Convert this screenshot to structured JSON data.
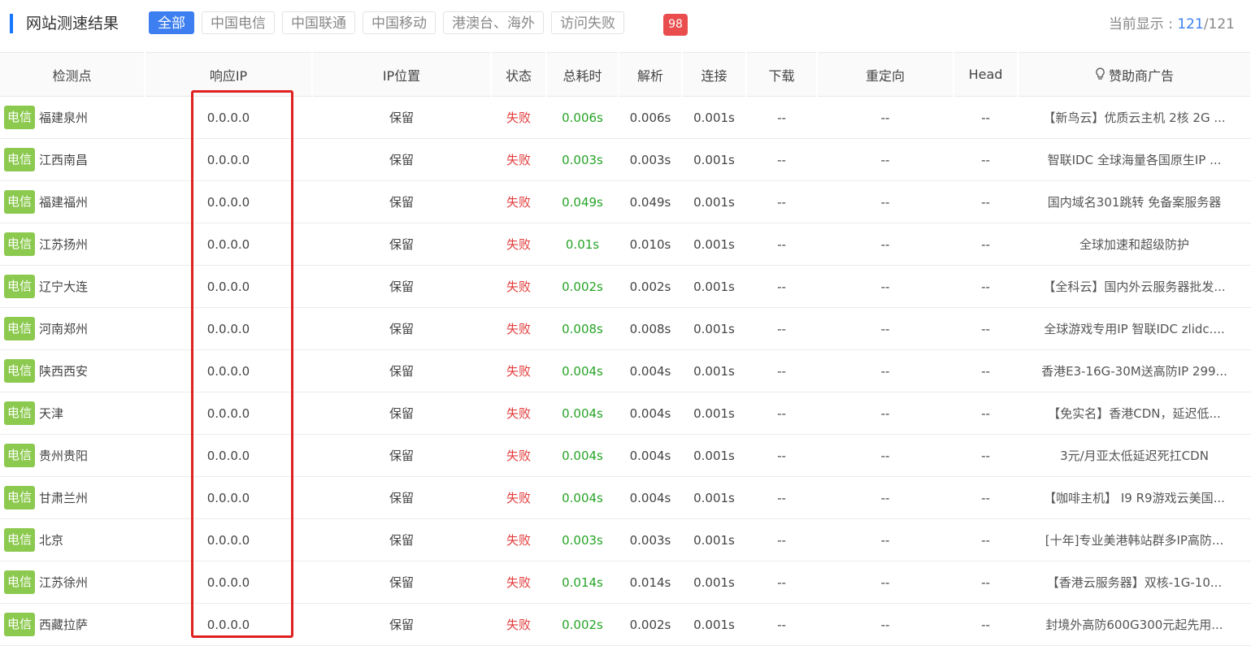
{
  "header": {
    "title": "网站测速结果",
    "filters": [
      "全部",
      "中国电信",
      "中国联通",
      "中国移动",
      "港澳台、海外",
      "访问失败"
    ],
    "failed_badge": "98",
    "count_label": "当前显示 : ",
    "count_shown": "121",
    "count_sep": "/",
    "count_total": "121"
  },
  "table": {
    "columns": [
      "检测点",
      "响应IP",
      "IP位置",
      "状态",
      "总耗时",
      "解析",
      "连接",
      "下载",
      "重定向",
      "Head",
      "赞助商广告"
    ],
    "sponsor_icon": "lightbulb-icon",
    "rows": [
      {
        "isp": "电信",
        "city": "福建泉州",
        "ip": "0.0.0.0",
        "loc": "保留",
        "status": "失败",
        "total": "0.006s",
        "dns": "0.006s",
        "connect": "0.001s",
        "download": "--",
        "redirect": "--",
        "head": "--",
        "ad": "【新鸟云】优质云主机 2核 2G ..."
      },
      {
        "isp": "电信",
        "city": "江西南昌",
        "ip": "0.0.0.0",
        "loc": "保留",
        "status": "失败",
        "total": "0.003s",
        "dns": "0.003s",
        "connect": "0.001s",
        "download": "--",
        "redirect": "--",
        "head": "--",
        "ad": "智联IDC 全球海量各国原生IP ..."
      },
      {
        "isp": "电信",
        "city": "福建福州",
        "ip": "0.0.0.0",
        "loc": "保留",
        "status": "失败",
        "total": "0.049s",
        "dns": "0.049s",
        "connect": "0.001s",
        "download": "--",
        "redirect": "--",
        "head": "--",
        "ad": "国内域名301跳转 免备案服务器"
      },
      {
        "isp": "电信",
        "city": "江苏扬州",
        "ip": "0.0.0.0",
        "loc": "保留",
        "status": "失败",
        "total": "0.01s",
        "dns": "0.010s",
        "connect": "0.001s",
        "download": "--",
        "redirect": "--",
        "head": "--",
        "ad": "全球加速和超级防护"
      },
      {
        "isp": "电信",
        "city": "辽宁大连",
        "ip": "0.0.0.0",
        "loc": "保留",
        "status": "失败",
        "total": "0.002s",
        "dns": "0.002s",
        "connect": "0.001s",
        "download": "--",
        "redirect": "--",
        "head": "--",
        "ad": "【全科云】国内外云服务器批发..."
      },
      {
        "isp": "电信",
        "city": "河南郑州",
        "ip": "0.0.0.0",
        "loc": "保留",
        "status": "失败",
        "total": "0.008s",
        "dns": "0.008s",
        "connect": "0.001s",
        "download": "--",
        "redirect": "--",
        "head": "--",
        "ad": "全球游戏专用IP 智联IDC zlidc...."
      },
      {
        "isp": "电信",
        "city": "陕西西安",
        "ip": "0.0.0.0",
        "loc": "保留",
        "status": "失败",
        "total": "0.004s",
        "dns": "0.004s",
        "connect": "0.001s",
        "download": "--",
        "redirect": "--",
        "head": "--",
        "ad": "香港E3-16G-30M送高防IP 299..."
      },
      {
        "isp": "电信",
        "city": "天津",
        "ip": "0.0.0.0",
        "loc": "保留",
        "status": "失败",
        "total": "0.004s",
        "dns": "0.004s",
        "connect": "0.001s",
        "download": "--",
        "redirect": "--",
        "head": "--",
        "ad": "【免实名】香港CDN，延迟低..."
      },
      {
        "isp": "电信",
        "city": "贵州贵阳",
        "ip": "0.0.0.0",
        "loc": "保留",
        "status": "失败",
        "total": "0.004s",
        "dns": "0.004s",
        "connect": "0.001s",
        "download": "--",
        "redirect": "--",
        "head": "--",
        "ad": "3元/月亚太低延迟死扛CDN"
      },
      {
        "isp": "电信",
        "city": "甘肃兰州",
        "ip": "0.0.0.0",
        "loc": "保留",
        "status": "失败",
        "total": "0.004s",
        "dns": "0.004s",
        "connect": "0.001s",
        "download": "--",
        "redirect": "--",
        "head": "--",
        "ad": "【咖啡主机】 I9 R9游戏云美国..."
      },
      {
        "isp": "电信",
        "city": "北京",
        "ip": "0.0.0.0",
        "loc": "保留",
        "status": "失败",
        "total": "0.003s",
        "dns": "0.003s",
        "connect": "0.001s",
        "download": "--",
        "redirect": "--",
        "head": "--",
        "ad": "[十年]专业美港韩站群多IP高防..."
      },
      {
        "isp": "电信",
        "city": "江苏徐州",
        "ip": "0.0.0.0",
        "loc": "保留",
        "status": "失败",
        "total": "0.014s",
        "dns": "0.014s",
        "connect": "0.001s",
        "download": "--",
        "redirect": "--",
        "head": "--",
        "ad": "【香港云服务器】双核-1G-10..."
      },
      {
        "isp": "电信",
        "city": "西藏拉萨",
        "ip": "0.0.0.0",
        "loc": "保留",
        "status": "失败",
        "total": "0.002s",
        "dns": "0.002s",
        "connect": "0.001s",
        "download": "--",
        "redirect": "--",
        "head": "--",
        "ad": "封境外高防600G300元起先用..."
      }
    ]
  }
}
